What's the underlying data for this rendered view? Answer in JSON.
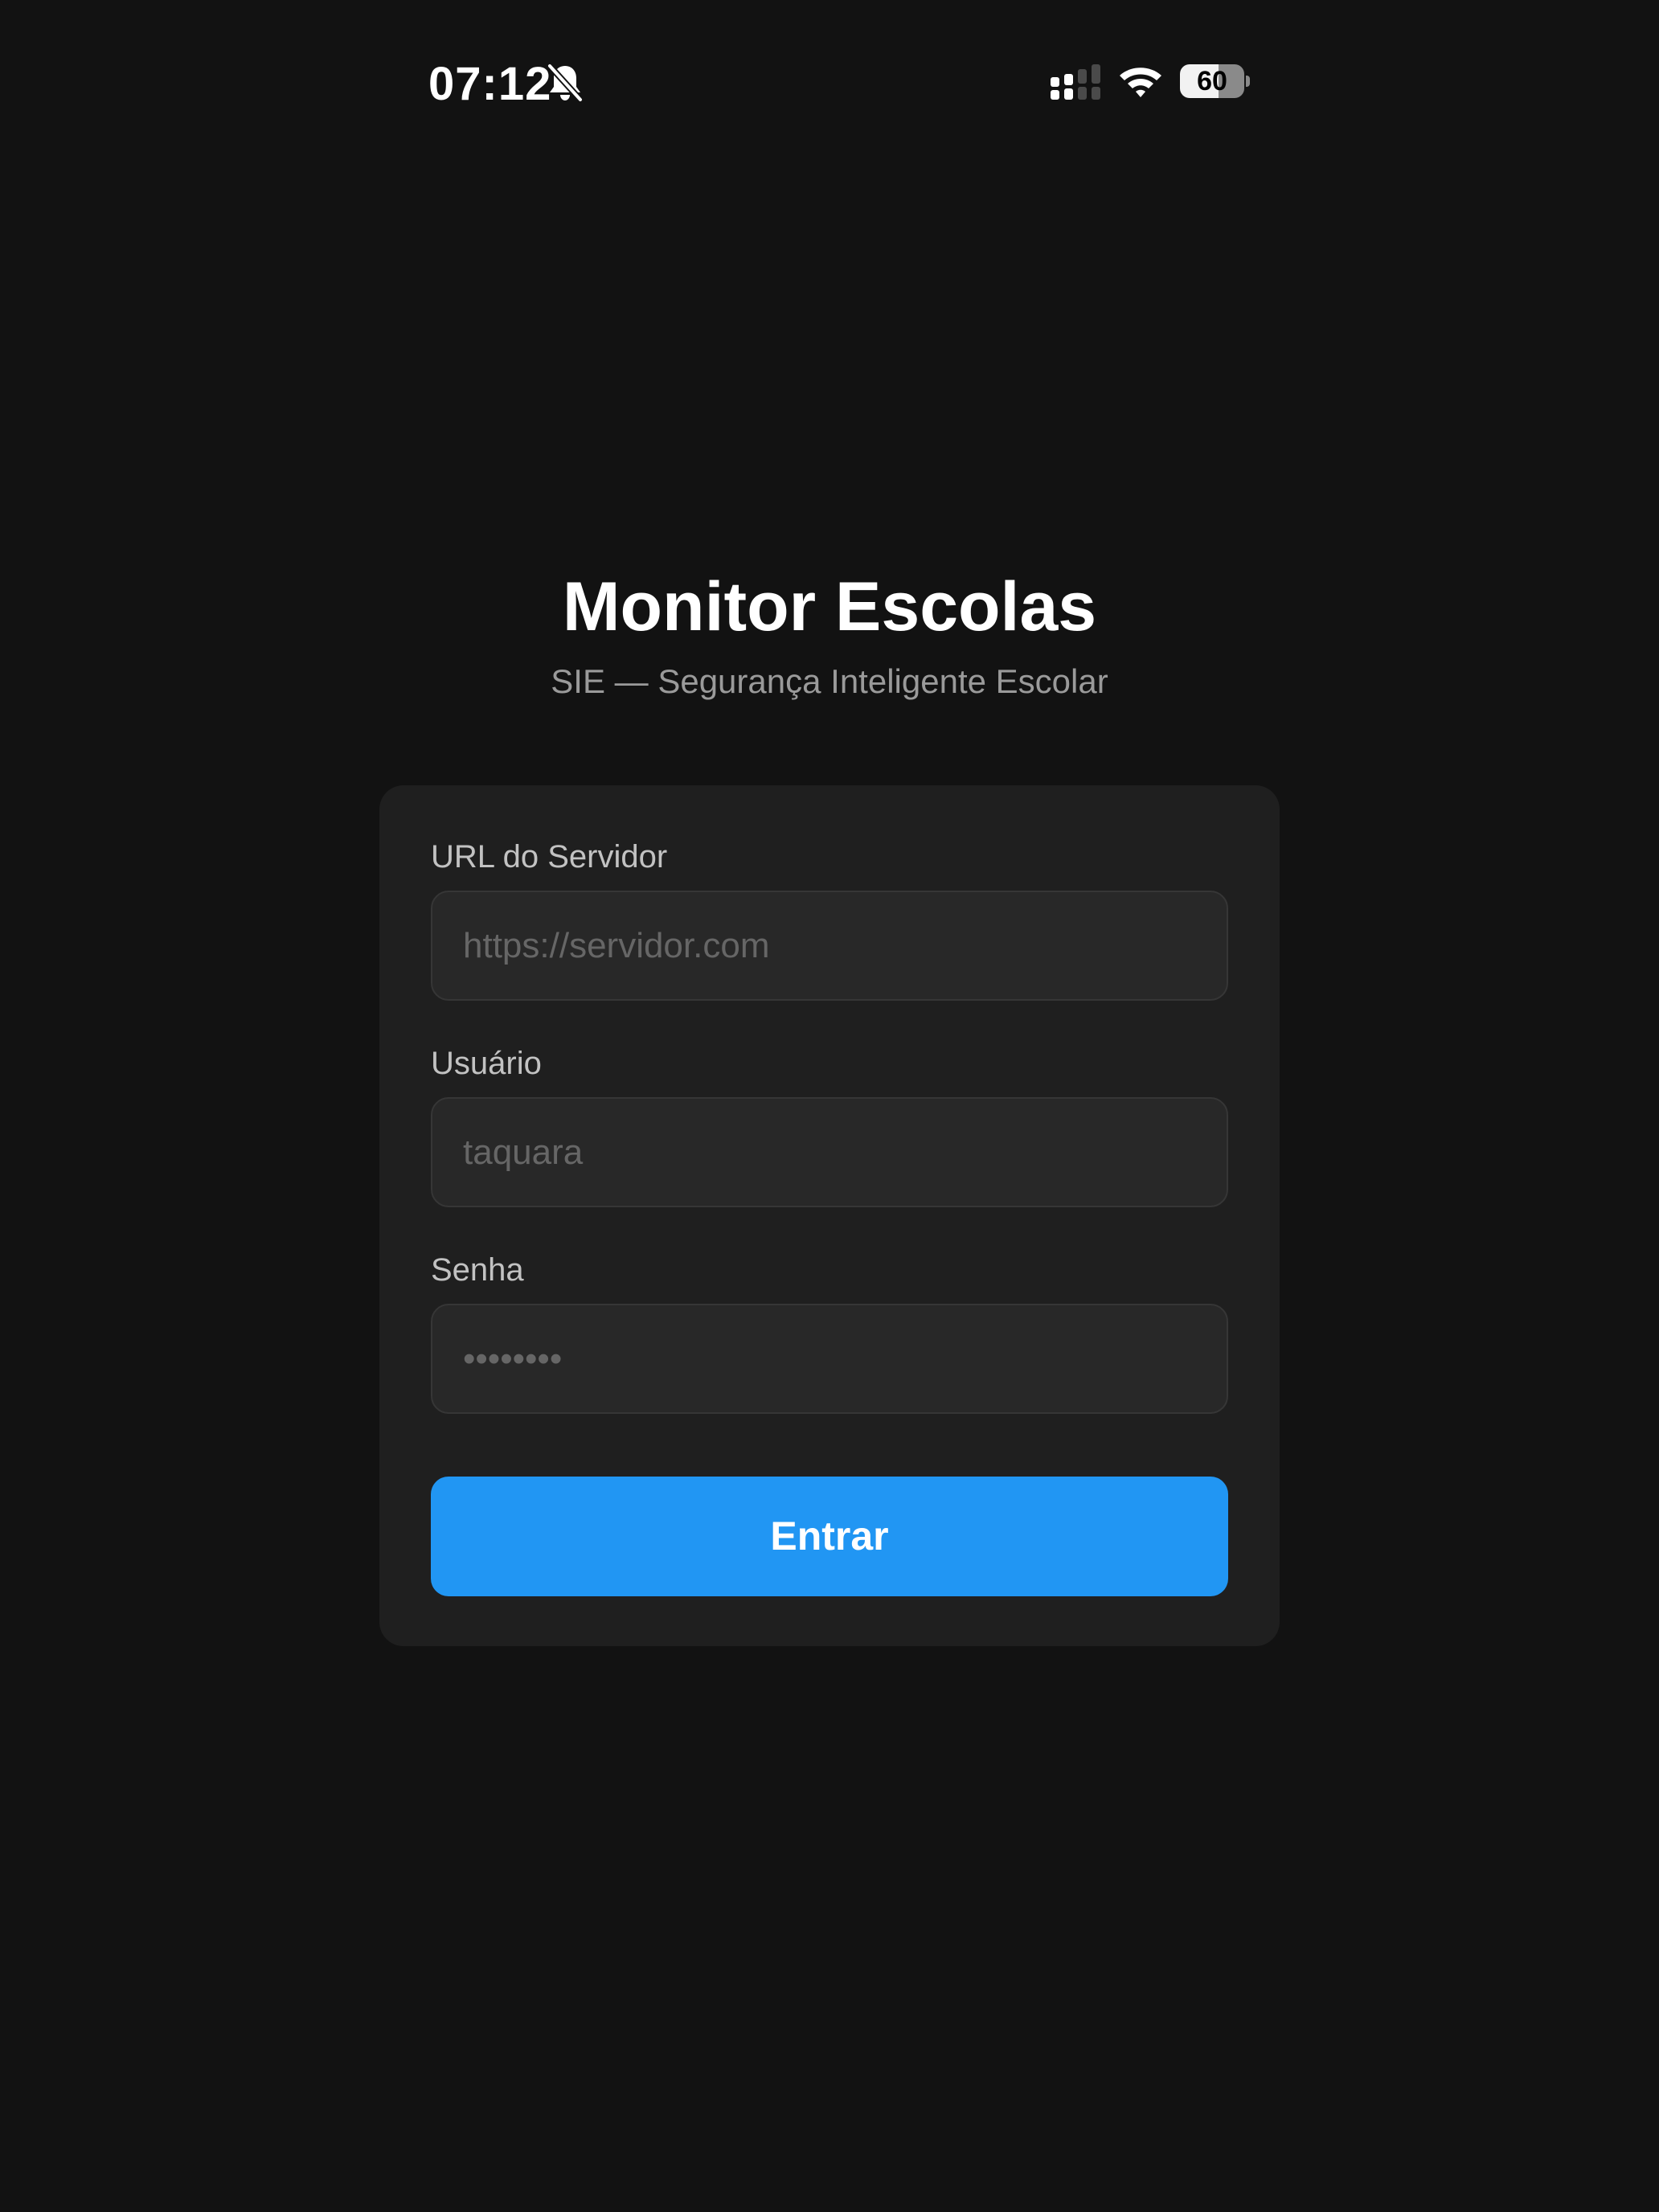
{
  "status_bar": {
    "time": "07:12",
    "battery_level": "60",
    "icons": [
      "bell-slash-icon",
      "signal-icon",
      "wifi-icon",
      "battery-icon"
    ]
  },
  "header": {
    "title": "Monitor Escolas",
    "subtitle": "SIE — Segurança Inteligente Escolar"
  },
  "form": {
    "server_url": {
      "label": "URL do Servidor",
      "placeholder": "https://servidor.com",
      "value": ""
    },
    "username": {
      "label": "Usuário",
      "placeholder": "taquara",
      "value": ""
    },
    "password": {
      "label": "Senha",
      "placeholder": "••••••••",
      "value": ""
    },
    "submit_label": "Entrar"
  },
  "colors": {
    "background": "#121212",
    "card": "#1f1f1f",
    "input": "#282828",
    "accent": "#2196f3",
    "label": "#c2c2c2",
    "subtitle": "#9a9a9a"
  }
}
